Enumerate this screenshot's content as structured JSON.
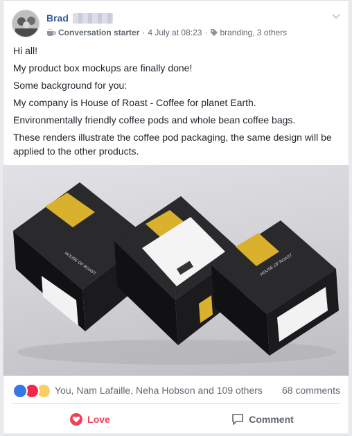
{
  "post": {
    "author": "Brad",
    "badge": "Conversation starter",
    "separator": "·",
    "timestamp": "4 July at 08:23",
    "tags": "branding, 3 others",
    "body": [
      "Hi all!",
      "My product box mockups are finally done!",
      "Some background for you:",
      "My company is House of Roast - Coffee for planet Earth.",
      "Environmentally friendly coffee pods and whole bean coffee bags.",
      "These renders illustrate the coffee pod packaging, the same design will be applied to the other products."
    ]
  },
  "reactions": {
    "icons": [
      "like-icon",
      "love-icon",
      "wow-icon"
    ],
    "names": "You, Nam Lafaille, Neha Hobson and 109 others",
    "comments": "68 comments"
  },
  "actions": {
    "love": "Love",
    "comment": "Comment"
  },
  "colors": {
    "link": "#365899",
    "love": "#f33e58",
    "like": "#3578e5",
    "box_black": "#1b1b1d",
    "box_gold": "#d9b12d"
  }
}
